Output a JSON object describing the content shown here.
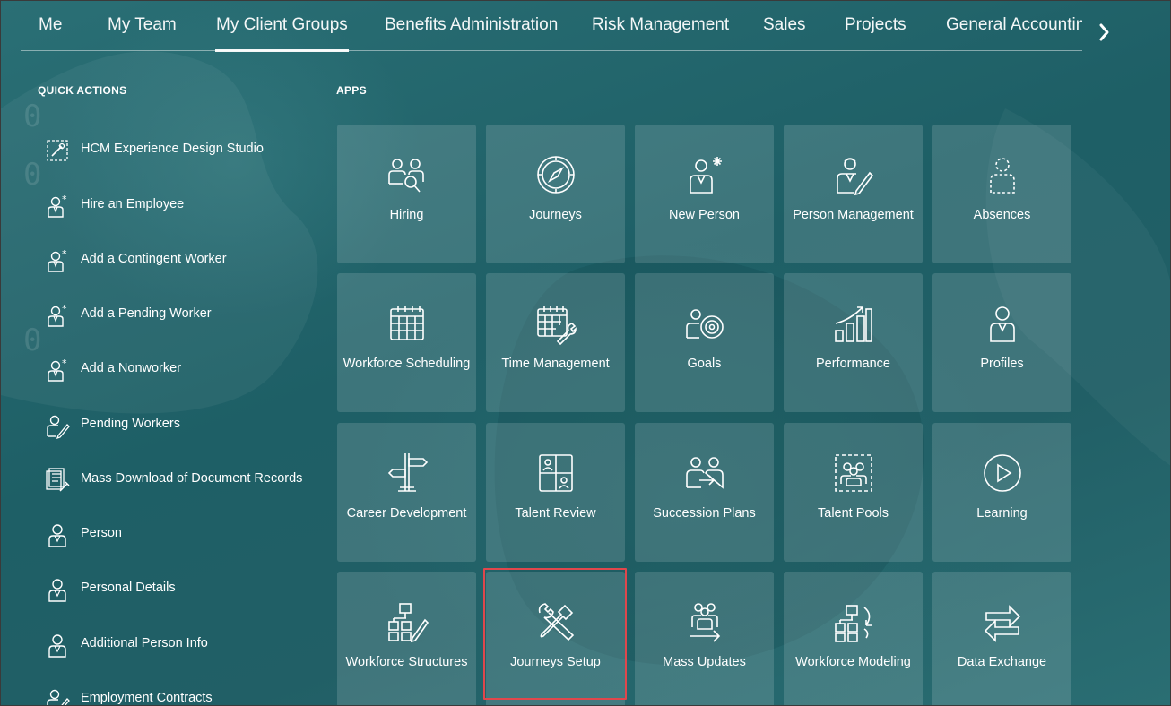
{
  "nav": {
    "tabs": [
      "Me",
      "My Client Groups",
      "Benefits Administration",
      "Risk Management",
      "Sales",
      "Projects",
      "General Accounting"
    ],
    "active_tab": "My Client Groups"
  },
  "quick_actions": {
    "title": "QUICK ACTIONS",
    "items": [
      {
        "label": "HCM Experience Design Studio",
        "icon": "design-studio-icon"
      },
      {
        "label": "Hire an Employee",
        "icon": "person-add-icon"
      },
      {
        "label": "Add a Contingent Worker",
        "icon": "person-add-icon"
      },
      {
        "label": "Add a Pending Worker",
        "icon": "person-add-icon"
      },
      {
        "label": "Add a Nonworker",
        "icon": "person-add-icon"
      },
      {
        "label": "Pending Workers",
        "icon": "person-edit-icon"
      },
      {
        "label": "Mass Download of Document Records",
        "icon": "documents-icon"
      },
      {
        "label": "Person",
        "icon": "person-icon"
      },
      {
        "label": "Personal Details",
        "icon": "person-icon"
      },
      {
        "label": "Additional Person Info",
        "icon": "person-icon"
      },
      {
        "label": "Employment Contracts",
        "icon": "person-edit-icon"
      }
    ]
  },
  "apps": {
    "title": "APPS",
    "tiles": [
      {
        "label": "Hiring",
        "icon": "hiring-icon"
      },
      {
        "label": "Journeys",
        "icon": "compass-icon"
      },
      {
        "label": "New Person",
        "icon": "new-person-icon"
      },
      {
        "label": "Person Management",
        "icon": "person-management-icon"
      },
      {
        "label": "Absences",
        "icon": "absences-icon"
      },
      {
        "label": "Workforce Scheduling",
        "icon": "calendar-icon"
      },
      {
        "label": "Time Management",
        "icon": "calendar-wrench-icon"
      },
      {
        "label": "Goals",
        "icon": "goals-icon"
      },
      {
        "label": "Performance",
        "icon": "performance-icon"
      },
      {
        "label": "Profiles",
        "icon": "profile-icon"
      },
      {
        "label": "Career Development",
        "icon": "signpost-icon"
      },
      {
        "label": "Talent Review",
        "icon": "talent-review-icon"
      },
      {
        "label": "Succession Plans",
        "icon": "succession-icon"
      },
      {
        "label": "Talent Pools",
        "icon": "talent-pools-icon"
      },
      {
        "label": "Learning",
        "icon": "play-icon"
      },
      {
        "label": "Workforce Structures",
        "icon": "structures-icon"
      },
      {
        "label": "Journeys Setup",
        "icon": "tools-icon"
      },
      {
        "label": "Mass Updates",
        "icon": "mass-updates-icon"
      },
      {
        "label": "Workforce Modeling",
        "icon": "modeling-icon"
      },
      {
        "label": "Data Exchange",
        "icon": "exchange-icon"
      }
    ],
    "highlighted_tile": "Journeys Setup"
  },
  "colors": {
    "background": "#1f6268",
    "tile": "#ffffff24",
    "highlight": "#e0474c"
  }
}
